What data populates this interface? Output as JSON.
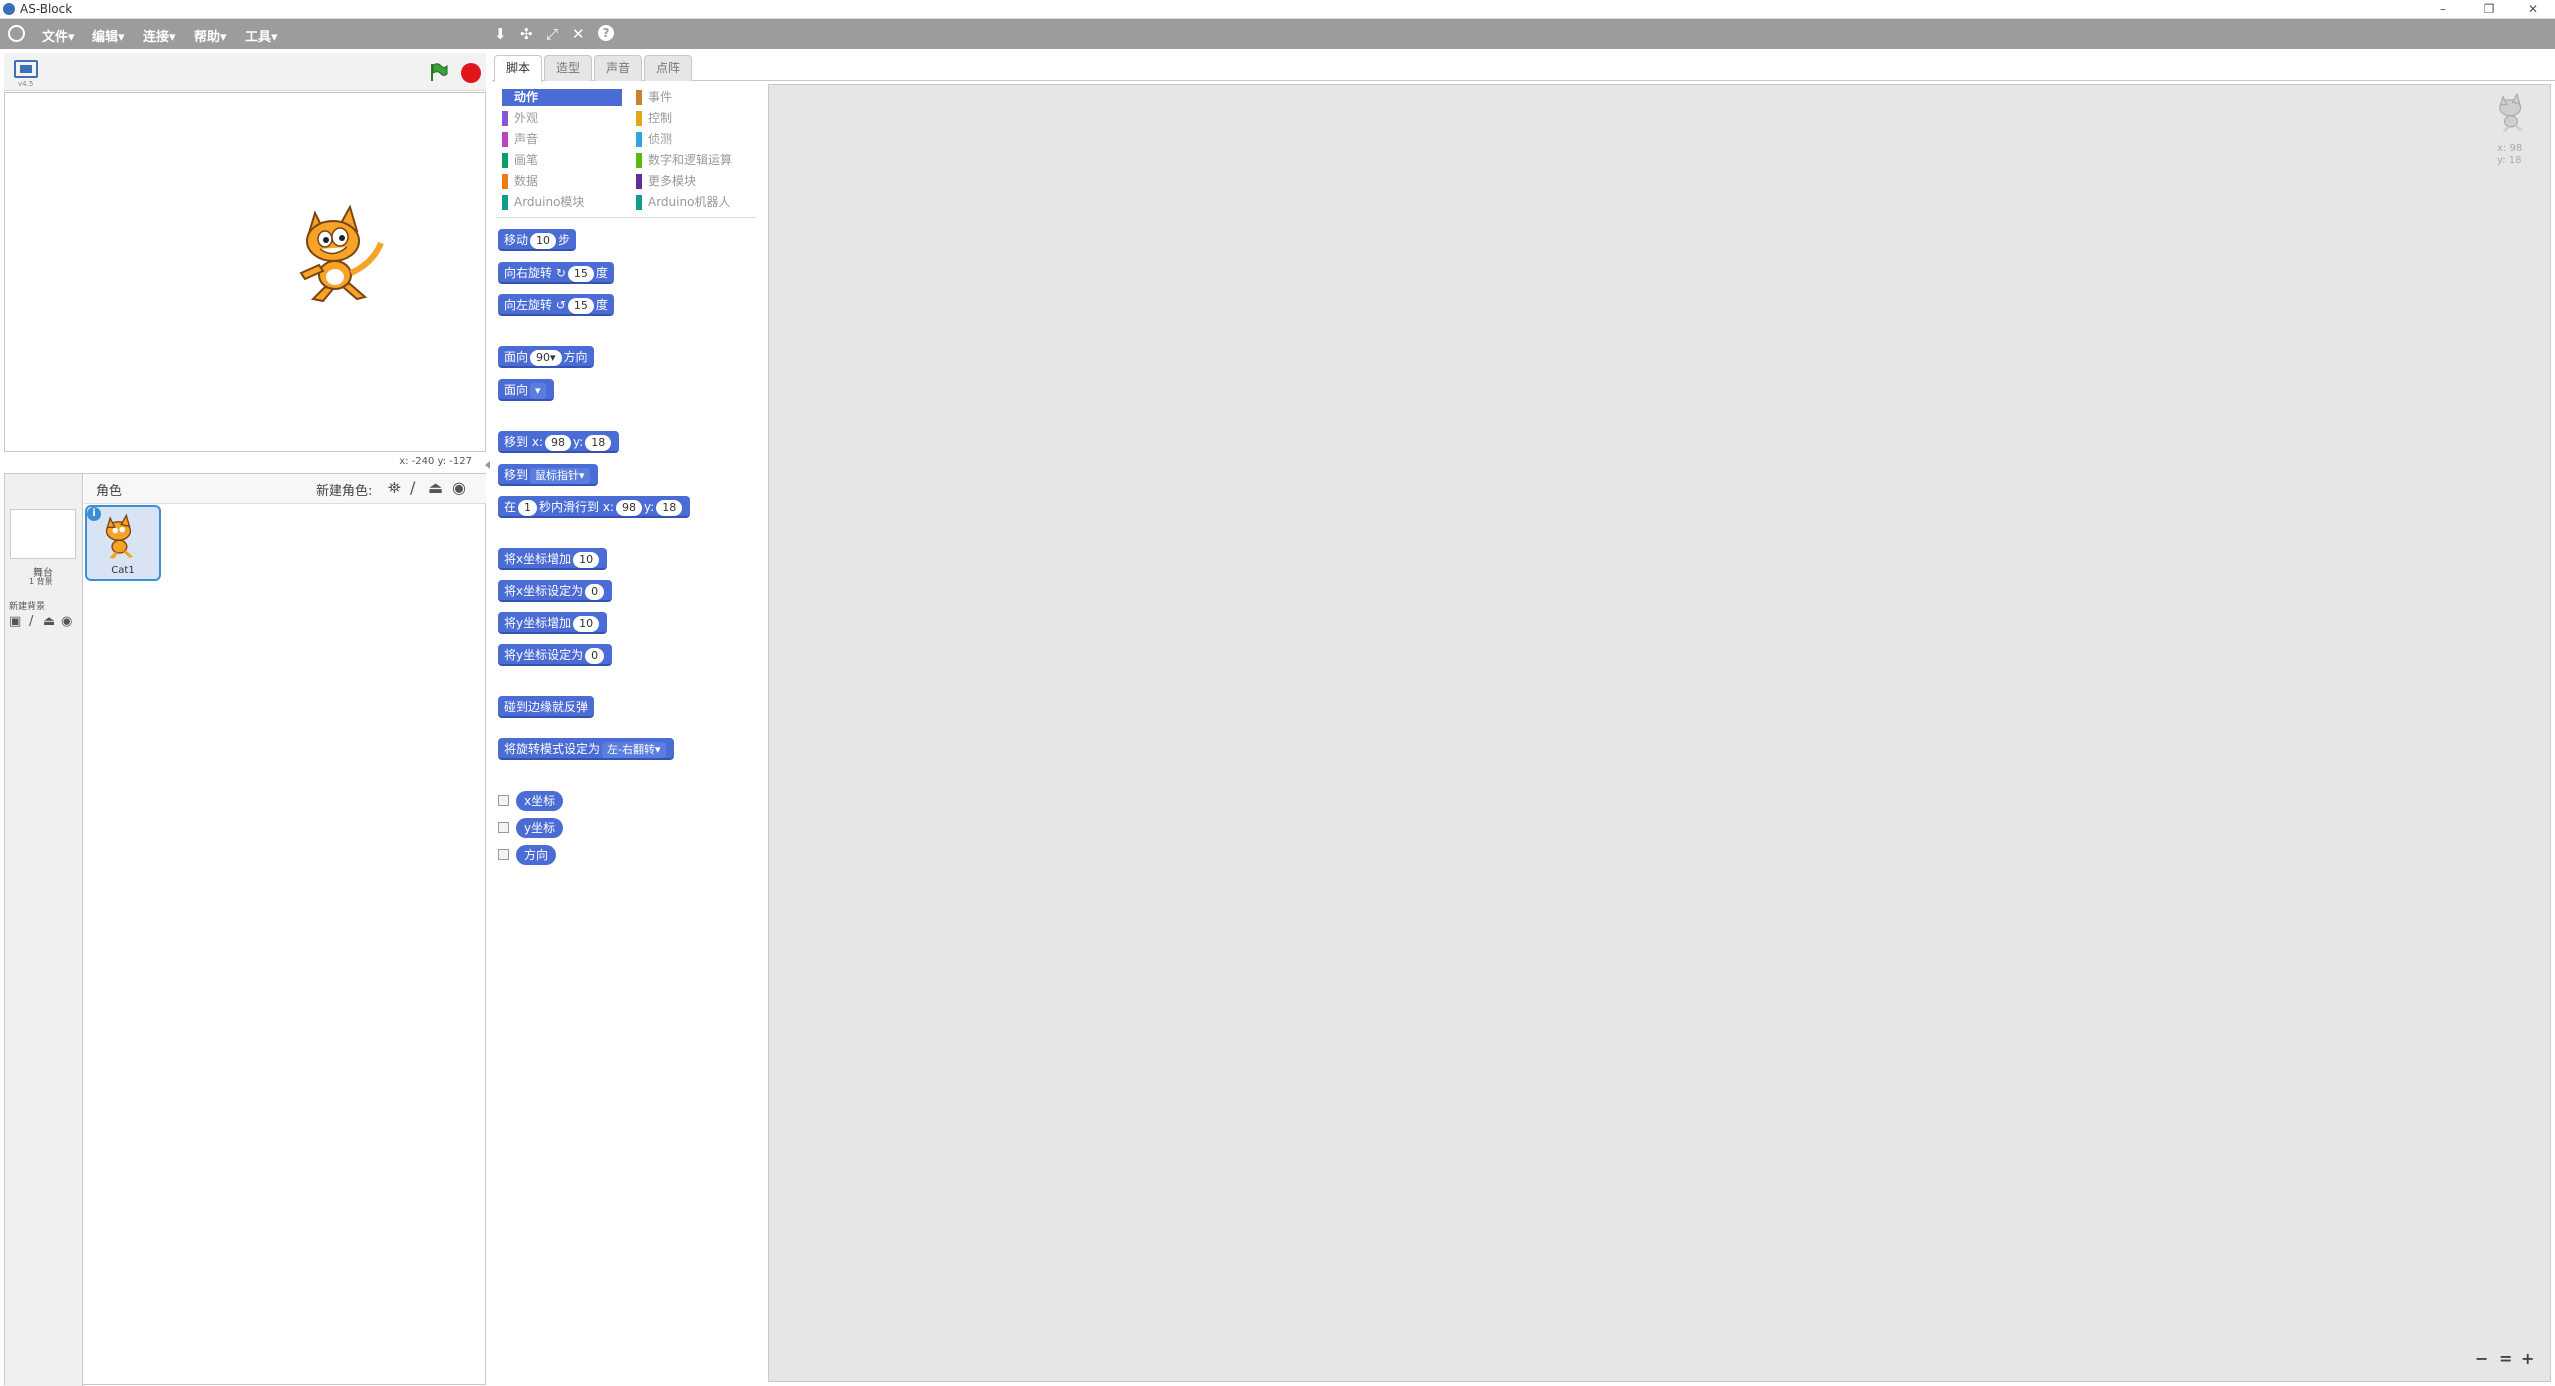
{
  "window": {
    "title": "AS-Block",
    "minimize": "–",
    "restore": "❐",
    "close": "✕"
  },
  "menu": {
    "items": [
      "文件▾",
      "编辑▾",
      "连接▾",
      "帮助▾",
      "工具▾"
    ]
  },
  "toolbar": {
    "icons": [
      "stamp-icon",
      "grow-icon",
      "fullscreen-icon",
      "shrink-icon",
      "help-icon"
    ]
  },
  "stage": {
    "version": "v4.5",
    "coords": "x: -240  y: -127"
  },
  "sprites": {
    "header": "角色",
    "new_sprite_label": "新建角色:",
    "stage_label": "舞台",
    "stage_backdrops": "1 背景",
    "new_backdrop_label": "新建背景",
    "sprite_name": "Cat1"
  },
  "tabs": [
    "脚本",
    "造型",
    "声音",
    "点阵"
  ],
  "categories": {
    "left": [
      {
        "label": "动作",
        "color": "#4a6cd4"
      },
      {
        "label": "外观",
        "color": "#8a55d7"
      },
      {
        "label": "声音",
        "color": "#bb42c3"
      },
      {
        "label": "画笔",
        "color": "#0e9a6c"
      },
      {
        "label": "数据",
        "color": "#ee7d16"
      },
      {
        "label": "Arduino模块",
        "color": "#0f9e8e"
      }
    ],
    "right": [
      {
        "label": "事件",
        "color": "#c88330"
      },
      {
        "label": "控制",
        "color": "#e1a91a"
      },
      {
        "label": "侦测",
        "color": "#2ca5e2"
      },
      {
        "label": "数字和逻辑运算",
        "color": "#5cb712"
      },
      {
        "label": "更多模块",
        "color": "#632d99"
      },
      {
        "label": "Arduino机器人",
        "color": "#0f9e8e"
      }
    ]
  },
  "blocks": {
    "move": {
      "a": "移动",
      "v": "10",
      "b": "步"
    },
    "turn_right": {
      "a": "向右旋转",
      "v": "15",
      "b": "度"
    },
    "turn_left": {
      "a": "向左旋转",
      "v": "15",
      "b": "度"
    },
    "point_dir": {
      "a": "面向",
      "v": "90▾",
      "b": "方向"
    },
    "point_towards": {
      "a": "面向",
      "v": "▾"
    },
    "goto_xy": {
      "a": "移到",
      "xl": "x:",
      "x": "98",
      "yl": "y:",
      "y": "18"
    },
    "goto": {
      "a": "移到",
      "v": "鼠标指针▾"
    },
    "glide": {
      "a": "在",
      "t": "1",
      "b": "秒内滑行到",
      "xl": "x:",
      "x": "98",
      "yl": "y:",
      "y": "18"
    },
    "change_x": {
      "a": "将x坐标增加",
      "v": "10"
    },
    "set_x": {
      "a": "将x坐标设定为",
      "v": "0"
    },
    "change_y": {
      "a": "将y坐标增加",
      "v": "10"
    },
    "set_y": {
      "a": "将y坐标设定为",
      "v": "0"
    },
    "bounce": {
      "a": "碰到边缘就反弹"
    },
    "rotation_style": {
      "a": "将旋转模式设定为",
      "v": "左-右翻转▾"
    },
    "rep_x": "x坐标",
    "rep_y": "y坐标",
    "rep_dir": "方向"
  },
  "script_area": {
    "sprite_x": "x: 98",
    "sprite_y": "y: 18",
    "zoom_out": "−",
    "zoom_reset": "=",
    "zoom_in": "+"
  }
}
